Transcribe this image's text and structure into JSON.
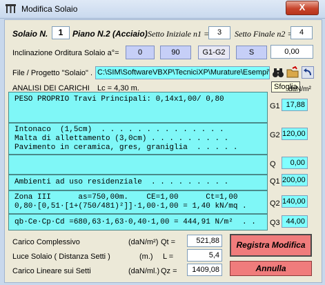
{
  "window": {
    "title": "Modifica Solaio",
    "close_label": "X"
  },
  "header": {
    "solaio_label": "Solaio N.",
    "solaio_value": "1",
    "piano_label": "Piano N.2 (Acciaio)",
    "setto_iniziale_label": "Setto Iniziale n1 =",
    "setto_iniziale_value": "3",
    "setto_finale_label": "Setto Finale n2 =",
    "setto_finale_value": "4"
  },
  "inclinazione": {
    "label": "Inclinazione Orditura Solaio  a°=",
    "buttons": [
      "0",
      "90",
      "G1-G2",
      "S"
    ],
    "selected": "G1-G2",
    "value": "0,00"
  },
  "file": {
    "label": "File / Progetto \"Solaio\" . .",
    "path": "C:\\SIM\\SoftwareVBXP\\TecniciXP\\Murature\\Esempi\\",
    "tooltip": "Sfoglia"
  },
  "analisi": {
    "title": "ANALISI DEI CARICHI",
    "lc": "Lc = 4,30 m.",
    "unit": "daN/m²"
  },
  "loads": [
    {
      "label": "G1",
      "value": "17,88",
      "lines": [
        "PESO PROPRIO Travi Principali: 0,14x1,00/ 0,80"
      ]
    },
    {
      "label": "G2",
      "value": "120,00",
      "lines": [
        "Intonaco  (1,5cm)  . . . . . . . . . . . . . .",
        "Malta di allettamento (3,0cm) . . . . . . . . .",
        "Pavimento in ceramica, gres, graniglia  . . . . ."
      ]
    },
    {
      "label": "Q",
      "value": "0,00",
      "lines": [
        ""
      ]
    },
    {
      "label": "Q1",
      "value": "200,00",
      "lines": [
        "Ambienti ad uso residenziale  . . . . . . . . ."
      ]
    },
    {
      "label": "Q2",
      "value": "140,00",
      "lines": [
        "Zona III      as=750,00m.    CE=1,00      Ct=1,00",
        "0,80·[0,51·[1+(750/481)²]]·1,00·1,00 = 1,40 kN/mq ."
      ]
    },
    {
      "label": "Q3",
      "value": "44,00",
      "lines": [
        "qb·Ce·Cp·Cd =680,63·1,63·0,40·1,00 = 444,91 N/m²  . ."
      ]
    }
  ],
  "summary": [
    {
      "label": "Carico Complessivo",
      "unit": "(daN/m²)",
      "symbol": "Qt =",
      "value": "521,88"
    },
    {
      "label": "Luce Solaio ( Distanza Setti )",
      "unit": "(m.)",
      "symbol": "L =",
      "value": "5,4"
    },
    {
      "label": "Carico Lineare sui Setti",
      "unit": "(daN/ml.)",
      "symbol": "Qz =",
      "value": "1409,08"
    }
  ],
  "actions": {
    "registra": "Registra Modifica",
    "annulla": "Annulla"
  }
}
